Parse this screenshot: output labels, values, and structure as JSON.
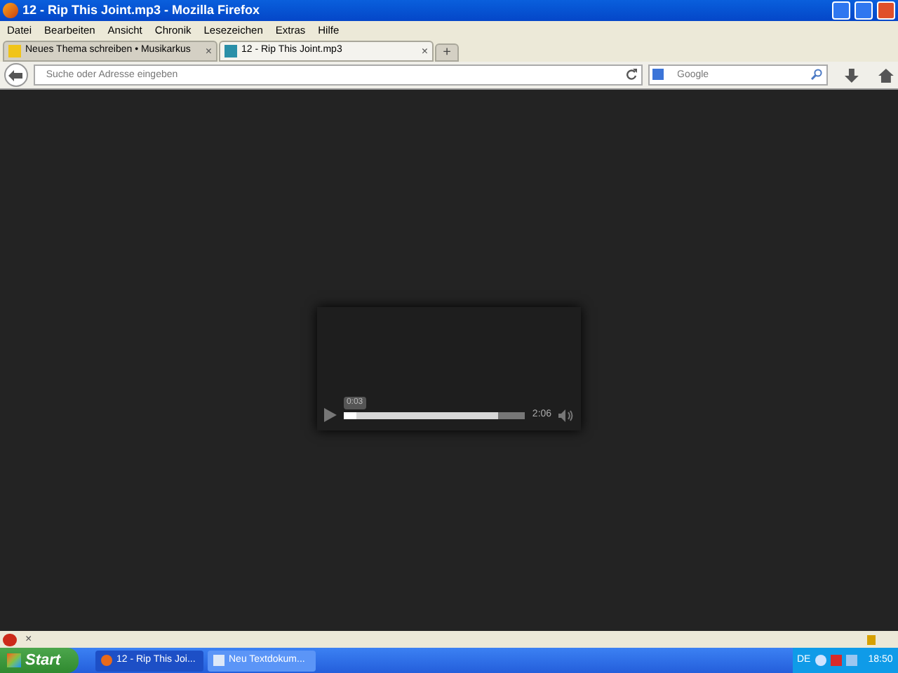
{
  "window": {
    "title": "12 - Rip This Joint.mp3 - Mozilla Firefox"
  },
  "menu": [
    "Datei",
    "Bearbeiten",
    "Ansicht",
    "Chronik",
    "Lesezeichen",
    "Extras",
    "Hilfe"
  ],
  "tabs": [
    {
      "label": "Neues Thema schreiben • Musikarkus",
      "selected": false,
      "close": "×"
    },
    {
      "label": "12 - Rip This Joint.mp3",
      "selected": true,
      "close": "×"
    }
  ],
  "new_tab": "+",
  "address": {
    "placeholder": "Suche oder Adresse eingeben"
  },
  "search": {
    "placeholder": "Google"
  },
  "player": {
    "tooltip": "0:03",
    "time": "2:06",
    "progress": {
      "level": 0.07
    },
    "buffer": {
      "level": 0.85
    }
  },
  "addon_bar": {
    "close": "×"
  },
  "taskbar": {
    "start": "Start",
    "tasks": [
      {
        "label": "12 - Rip This Joi...",
        "selected": false,
        "kind": "browser"
      },
      {
        "label": "Neu Textdokum...",
        "selected": true,
        "kind": "document"
      }
    ],
    "language": "DE",
    "clock": "18:50"
  }
}
